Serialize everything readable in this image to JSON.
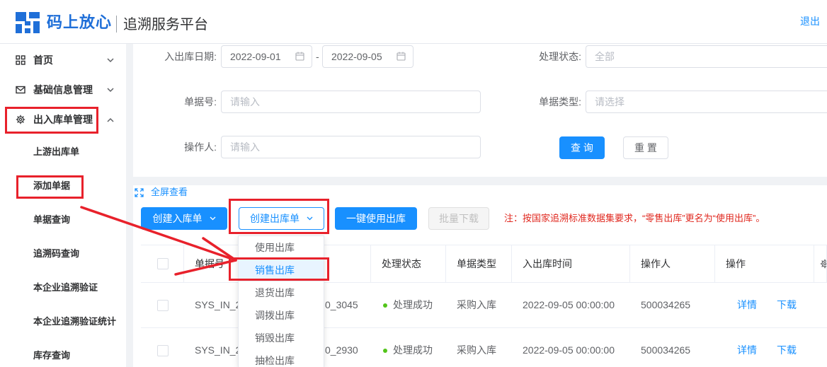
{
  "header": {
    "brand": "码上放心",
    "platform": "追溯服务平台",
    "logout": "退出"
  },
  "sidebar": {
    "menu": [
      {
        "label": "首页",
        "icon": "grid-icon",
        "expanded": false
      },
      {
        "label": "基础信息管理",
        "icon": "mail-icon",
        "expanded": false
      },
      {
        "label": "出入库单管理",
        "icon": "gear-icon",
        "expanded": true
      }
    ],
    "submenu": [
      "上游出库单",
      "添加单据",
      "单据查询",
      "追溯码查询",
      "本企业追溯验证",
      "本企业追溯验证统计",
      "库存查询"
    ]
  },
  "filters": {
    "date_label": "入出库日期:",
    "date_start": "2022-09-01",
    "date_separator": "-",
    "date_end": "2022-09-05",
    "status_label": "处理状态:",
    "status_placeholder": "全部",
    "doc_no_label": "单据号:",
    "doc_no_placeholder": "请输入",
    "doc_type_label": "单据类型:",
    "doc_type_placeholder": "请选择",
    "operator_label": "操作人:",
    "operator_placeholder": "请输入",
    "query_button": "查 询",
    "reset_button": "重 置"
  },
  "toolbar": {
    "fullscreen": "全屏查看",
    "create_inbound": "创建入库单",
    "create_outbound": "创建出库单",
    "one_click_use_outbound": "一键使用出库",
    "batch_download": "批量下载",
    "batch_download_disabled": true,
    "note": "注：按国家追溯标准数据集要求，“零售出库”更名为“使用出库”。"
  },
  "outbound_menu": {
    "items": [
      "使用出库",
      "销售出库",
      "退货出库",
      "调拨出库",
      "销毁出库",
      "抽检出库"
    ],
    "highlighted_index": 1
  },
  "table": {
    "columns": [
      "单据号",
      "处理状态",
      "单据类型",
      "入出库时间",
      "操作人",
      "操作"
    ],
    "rows": [
      {
        "doc_no_start": "SYS_IN_20",
        "doc_no_end": "0_3045",
        "status": "处理成功",
        "doc_type": "采购入库",
        "time": "2022-09-05 00:00:00",
        "operator": "500034265",
        "actions": [
          "详情",
          "下载"
        ]
      },
      {
        "doc_no_start": "SYS_IN_20",
        "doc_no_end": "0_2930",
        "status": "处理成功",
        "doc_type": "采购入库",
        "time": "2022-09-05 00:00:00",
        "operator": "500034265",
        "actions": [
          "详情",
          "下载"
        ]
      }
    ]
  },
  "colors": {
    "primary": "#1890ff",
    "brand": "#1f6fd8",
    "success": "#52c41a",
    "note_red": "#e0281f",
    "annotation_red": "#e8212b"
  }
}
